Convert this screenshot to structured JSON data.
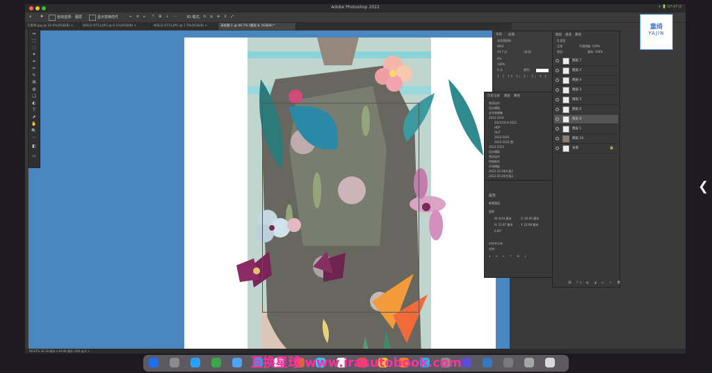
{
  "app": {
    "title": "Adobe Photoshop 2022"
  },
  "menubar": {
    "right_text": "✈ 🔋 07:47  Q"
  },
  "options_bar": {
    "auto_select_label": "自动选择:",
    "auto_select_value": "图层",
    "show_transform_label": "显示变换控件",
    "mode_3d_label": "3D 模式:"
  },
  "tabs": [
    {
      "label": "工资单.jpg @ 16.9%(RGB/8) ×"
    },
    {
      "label": "WSG2-0713.JPG @ 9.1%(RGB/8) ×"
    },
    {
      "label": "WSG2-0713.JPG @ 7.5%(RGB/8) ×"
    },
    {
      "label": "未标题-1 @ 66.7% (图层 8, RGB/8) *"
    }
  ],
  "toolbar": {
    "tools": [
      "↔",
      "⬚",
      "◌",
      "✦",
      "⌗",
      "✂",
      "✎",
      "⌘",
      "◍",
      "❏",
      "◐",
      "T",
      "⬈",
      "✋",
      "🔍",
      "···",
      "◧",
      "▭"
    ]
  },
  "props_panel": {
    "tabs": [
      "字符",
      "段落"
    ],
    "rows": [
      "仓耳渔阳体",
      "W04",
      "34.7 点",
      "(自动)",
      "0%",
      "100%",
      "0 点",
      "颜色:"
    ]
  },
  "history_panel": {
    "tabs": [
      "历史记录",
      "图层",
      "路径"
    ],
    "items": [
      "常用动作",
      "设计模板",
      "艺术效果集",
      "2022-1014",
      "20221014-1022",
      "HDP",
      "OLIT",
      "2022-1021",
      "2022-1022 图",
      "2022-1023",
      "设计模板",
      "常用动作",
      "特效制作",
      "开场模板",
      "2022-10-28/片段1",
      "2022-10-29/片段2"
    ],
    "properties_title": "属性",
    "pixel_layer_label": "像素图层",
    "transform_label": "变换",
    "w_label": "W: 8.64 厘米",
    "h_label": "H: 11.87 厘米",
    "x_label": "X: 26.93 厘米",
    "y_label": "Y: 24.68 厘米",
    "angle_label": "0.00°",
    "align_label": "对齐并分布",
    "align_sub": "对齐:"
  },
  "layers_panel": {
    "tabs": [
      "图层",
      "通道",
      "路径"
    ],
    "kind_label": "Q 类型",
    "blend_mode": "正常",
    "opacity_label": "不透明度: 100%",
    "lock_label": "锁定:",
    "fill_label": "填充: 100%",
    "layers": [
      {
        "name": "图层 7",
        "selected": false
      },
      {
        "name": "图层 2",
        "selected": false
      },
      {
        "name": "图层 4",
        "selected": false
      },
      {
        "name": "图层 3",
        "selected": false
      },
      {
        "name": "图层 5",
        "selected": false
      },
      {
        "name": "图层 6",
        "selected": false
      },
      {
        "name": "图层 8",
        "selected": true
      },
      {
        "name": "图层 1",
        "selected": false
      },
      {
        "name": "图层 10",
        "selected": false
      },
      {
        "name": "背景",
        "selected": false
      }
    ]
  },
  "status_bar": {
    "text": "66.67%   26.18 厘米 x 40.90 厘米 (300 ppi)   >"
  },
  "logo": {
    "cn": "童绮",
    "en": "YAJIN"
  },
  "dock": {
    "watermark": "互换星球 www.irasutobook.com",
    "icons": [
      {
        "color": "#1e6ef0"
      },
      {
        "color": "#8a8a8a"
      },
      {
        "color": "#2aa1f5"
      },
      {
        "color": "#3aa84a"
      },
      {
        "color": "#4ea4f6"
      },
      {
        "color": "#2f9bf2"
      },
      {
        "color": "#f0f0f0"
      },
      {
        "color": "#e35d40"
      },
      {
        "color": "#35c0ff"
      },
      {
        "color": "#ffffff"
      },
      {
        "color": "#e64a4a"
      },
      {
        "color": "#f6c024"
      },
      {
        "color": "#ff7a28"
      },
      {
        "color": "#1fb2ff"
      },
      {
        "color": "#8c8c8c"
      },
      {
        "color": "#5a4fd8"
      },
      {
        "color": "#3478c0"
      },
      {
        "color": "#7a7a7a"
      },
      {
        "color": "#a5a5a5"
      },
      {
        "color": "#d9d9d9"
      }
    ]
  },
  "side": {
    "chevron": "❮"
  }
}
